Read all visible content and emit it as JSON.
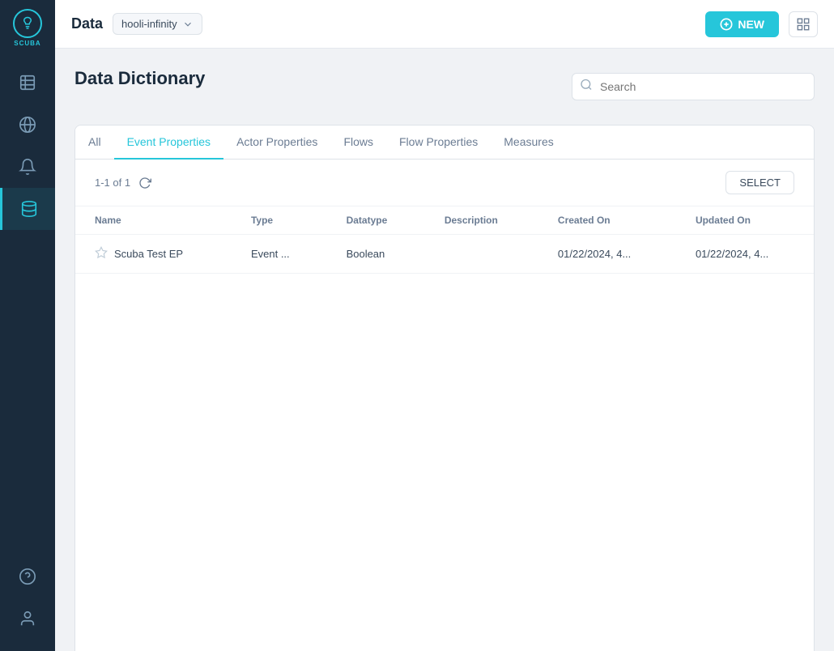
{
  "app": {
    "logo_letters": "⚡",
    "logo_text": "SCUBA"
  },
  "header": {
    "title": "Data",
    "workspace": "hooli-infinity",
    "new_button": "NEW",
    "search_placeholder": "Search"
  },
  "sidebar": {
    "items": [
      {
        "id": "table-icon",
        "label": "Tables"
      },
      {
        "id": "globe-icon",
        "label": "Globe"
      },
      {
        "id": "bell-icon",
        "label": "Notifications"
      },
      {
        "id": "database-icon",
        "label": "Database"
      }
    ],
    "bottom_items": [
      {
        "id": "help-icon",
        "label": "Help"
      },
      {
        "id": "user-icon",
        "label": "User"
      }
    ]
  },
  "page": {
    "title": "Data Dictionary"
  },
  "tabs": [
    {
      "id": "all",
      "label": "All",
      "active": false
    },
    {
      "id": "event-properties",
      "label": "Event Properties",
      "active": true
    },
    {
      "id": "actor-properties",
      "label": "Actor Properties",
      "active": false
    },
    {
      "id": "flows",
      "label": "Flows",
      "active": false
    },
    {
      "id": "flow-properties",
      "label": "Flow Properties",
      "active": false
    },
    {
      "id": "measures",
      "label": "Measures",
      "active": false
    }
  ],
  "table": {
    "count_label": "1-1 of 1",
    "select_button": "SELECT",
    "columns": [
      {
        "id": "name",
        "label": "Name"
      },
      {
        "id": "type",
        "label": "Type"
      },
      {
        "id": "datatype",
        "label": "Datatype"
      },
      {
        "id": "description",
        "label": "Description"
      },
      {
        "id": "created_on",
        "label": "Created On"
      },
      {
        "id": "updated_on",
        "label": "Updated On"
      }
    ],
    "rows": [
      {
        "name": "Scuba Test EP",
        "type": "Event ...",
        "datatype": "Boolean",
        "description": "",
        "created_on": "01/22/2024, 4...",
        "updated_on": "01/22/2024, 4...",
        "starred": false
      }
    ]
  }
}
